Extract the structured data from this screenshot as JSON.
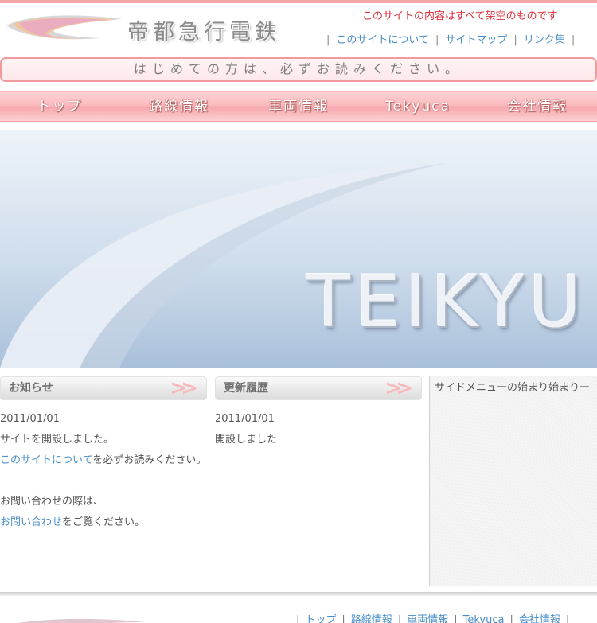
{
  "header": {
    "title": "帝都急行電鉄",
    "notice": "このサイトの内容はすべて架空のものです",
    "links": [
      "このサイトについて",
      "サイトマップ",
      "リンク集"
    ],
    "separator": "|"
  },
  "banner_text": "はじめての方は、必ずお読みください。",
  "nav": [
    "トップ",
    "路線情報",
    "車両情報",
    "Tekyuca",
    "会社情報"
  ],
  "hero": {
    "text": "TEIKYU"
  },
  "news": {
    "heading": "お知らせ",
    "date": "2011/01/01",
    "line1": "サイトを開設しました。",
    "link1": "このサイトについて",
    "line2_suffix": "を必ずお読みください。",
    "line3": "お問い合わせの際は、",
    "link2": "お問い合わせ",
    "line4_suffix": "をご覧ください。"
  },
  "updates": {
    "heading": "更新履歴",
    "date": "2011/01/01",
    "line1": "開設しました"
  },
  "sidebar": {
    "text": "サイドメニューの始まり始まりー"
  },
  "footer": {
    "links": [
      "トップ",
      "路線情報",
      "車両情報",
      "Tekyuca",
      "会社情報"
    ]
  },
  "colors": {
    "accent": "#f1a6aa",
    "link": "#4a8ec9",
    "notice": "#d9313a"
  }
}
